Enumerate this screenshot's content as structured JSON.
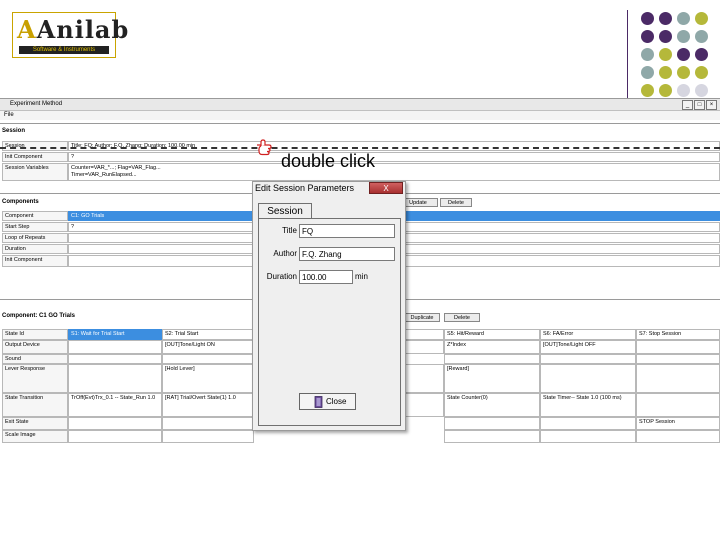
{
  "logo": {
    "text": "Anilab",
    "tagline": "Software & Instruments"
  },
  "window": {
    "title": "Experiment Method",
    "menu_file": "File",
    "controls": [
      "_",
      "□",
      "×"
    ]
  },
  "session": {
    "heading": "Session",
    "rows": [
      {
        "label": "Session",
        "value": "Title: FQ; Author: F.Q. Zhang; Duration: 100.00 min"
      },
      {
        "label": "Init Component",
        "value": "?"
      },
      {
        "label": "Session Variables",
        "value": "Counter=VAR_*...; Flag=VAR_Flag..."
      }
    ],
    "extra_line": "Timer=VAR_RunElapsed..."
  },
  "annotation": {
    "text": "double click",
    "icon": "pointing-hand-icon"
  },
  "components": {
    "heading": "Components",
    "buttons": [
      "Update",
      "Delete"
    ],
    "rows": [
      {
        "label": "Component",
        "value": "C1: GO Trials"
      },
      {
        "label": "Start Step",
        "value": "?"
      },
      {
        "label": "Loop of Repeats",
        "value": ""
      },
      {
        "label": "Duration",
        "value": ""
      },
      {
        "label": "Init Component",
        "value": ""
      }
    ]
  },
  "trials": {
    "heading": "Component: C1 GO Trials",
    "buttons": [
      "Duplicate",
      "Delete"
    ],
    "row_labels": [
      "State Id",
      "Output Device",
      "Sound",
      "Lever Response",
      "State Transition",
      "Exit State",
      "Scale Image"
    ],
    "states": [
      {
        "id": "S1: Wait for Trial Start",
        "output": "",
        "sound": "",
        "lever": "",
        "transition": "TrOff(Evt)Trx_0.1 -- State_Run 1.0",
        "transition2": "",
        "exit": ""
      },
      {
        "id": "S2: Trial Start",
        "output": "[OUT]Tone/Light ON",
        "sound": "",
        "lever": "[Hold Lever]",
        "transition": "[RAT] Trial/Overt State(1) 1.0",
        "transition2": "",
        "exit": ""
      },
      {
        "id": "S5: Hit/Reward",
        "output": "Z*Index",
        "sound": "",
        "lever": "[Reward]",
        "transition": "State Counter(0)",
        "transition2": "",
        "exit": ""
      },
      {
        "id": "S6: FA/Error",
        "output": "[OUT]Tone/Light OFF",
        "sound": "",
        "lever": "",
        "transition": "State Timer-- State 1.0 (100 ms)",
        "transition2": "",
        "exit": ""
      },
      {
        "id": "S7: Stop Session",
        "output": "",
        "sound": "",
        "lever": "",
        "transition": "",
        "transition2": "",
        "exit": "STOP Session"
      }
    ]
  },
  "dialog": {
    "title": "Edit Session Parameters",
    "close_glyph": "X",
    "tab": "Session",
    "title_label": "Title",
    "title_value": "FQ",
    "author_label": "Author",
    "author_value": "F.Q. Zhang",
    "duration_label": "Duration",
    "duration_value": "100.00",
    "duration_unit": "min",
    "close_button": "Close"
  },
  "colors": {
    "dot_purple": "#4b2a66",
    "dot_teal": "#8fa8a8",
    "dot_olive": "#b5b83a",
    "dot_light": "#d6d6e0",
    "selection": "#3c8ee0"
  }
}
